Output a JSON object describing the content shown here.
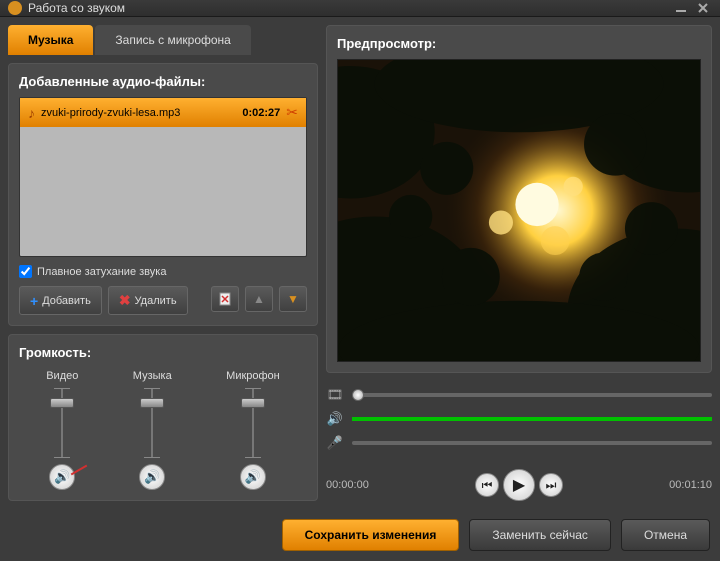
{
  "window": {
    "title": "Работа со звуком"
  },
  "tabs": {
    "music": "Музыка",
    "mic": "Запись с микрофона"
  },
  "added": {
    "title": "Добавленные аудио-файлы:",
    "files": [
      {
        "name": "zvuki-prirody-zvuki-lesa.mp3",
        "duration": "0:02:27"
      }
    ],
    "fade": "Плавное затухание звука"
  },
  "buttons": {
    "add": "Добавить",
    "delete": "Удалить"
  },
  "volume": {
    "title": "Громкость:",
    "video": "Видео",
    "music": "Музыка",
    "mic": "Микрофон"
  },
  "preview": {
    "title": "Предпросмотр:"
  },
  "time": {
    "current": "00:00:00",
    "total": "00:01:10"
  },
  "footer": {
    "save": "Сохранить изменения",
    "replace": "Заменить сейчас",
    "cancel": "Отмена"
  }
}
